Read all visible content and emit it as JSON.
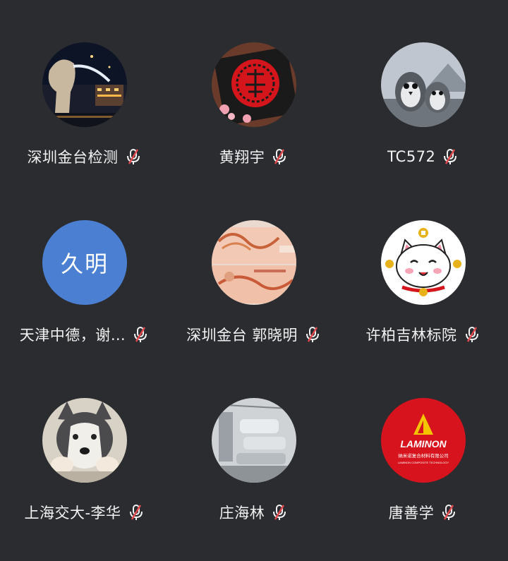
{
  "participants": [
    {
      "name": "深圳金台检测",
      "avatar": "merlion-night-photo",
      "muted": true
    },
    {
      "name": "黄翔宇",
      "avatar": "red-fu-papercut-photo",
      "muted": true
    },
    {
      "name": "TC572",
      "avatar": "penguins-photo",
      "muted": true
    },
    {
      "name": "天津中德，谢…",
      "avatar_text": "久明",
      "avatar_color": "#4a7fd1",
      "muted": true
    },
    {
      "name": "深圳金台 郭晓明",
      "avatar": "banknote-photo",
      "muted": true
    },
    {
      "name": "许柏吉林标院",
      "avatar": "lucky-cat-drawing",
      "muted": true
    },
    {
      "name": "上海交大-李华",
      "avatar": "husky-dog-photo",
      "muted": true
    },
    {
      "name": "庄海林",
      "avatar": "factory-machine-photo",
      "muted": true
    },
    {
      "name": "唐善学",
      "avatar": "laminon-logo",
      "muted": true,
      "logo_text": "LAMINON",
      "logo_sub": "纳米诺复合材料有限公司",
      "logo_sub2": "LAMINON COMPOSITE TECHNOLOGY"
    }
  ],
  "colors": {
    "background": "#2b2c2f",
    "mute_slash": "#e5484d",
    "text": "#f2f2f2"
  }
}
